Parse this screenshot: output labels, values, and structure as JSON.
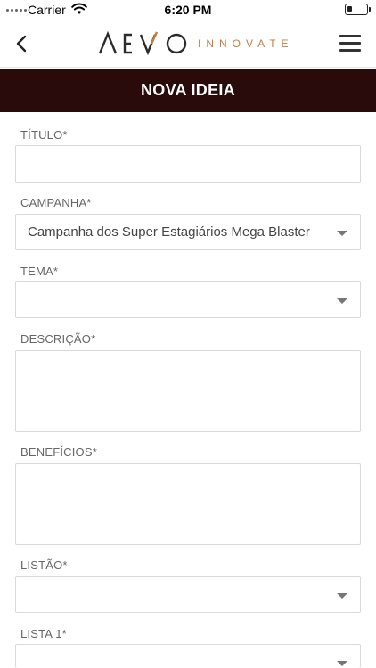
{
  "status_bar": {
    "carrier": "Carrier",
    "time": "6:20 PM"
  },
  "nav": {
    "logo_text": "AEVO",
    "logo_subtitle": "INNOVATE",
    "back_icon": "chevron-left-icon",
    "menu_icon": "hamburger-menu-icon"
  },
  "page": {
    "title": "NOVA IDEIA",
    "title_bg": "#2a0b0b",
    "accent": "#c77a3f"
  },
  "form": {
    "titulo": {
      "label": "TÍTULO*",
      "value": ""
    },
    "campanha": {
      "label": "CAMPANHA*",
      "value": "Campanha dos Super Estagiários Mega Blaster"
    },
    "tema": {
      "label": "TEMA*",
      "value": ""
    },
    "descricao": {
      "label": "DESCRIÇÃO*",
      "value": ""
    },
    "beneficios": {
      "label": "BENEFÍCIOS*",
      "value": ""
    },
    "listao": {
      "label": "LISTÃO*",
      "value": ""
    },
    "lista1": {
      "label": "LISTA 1*",
      "value": ""
    }
  }
}
